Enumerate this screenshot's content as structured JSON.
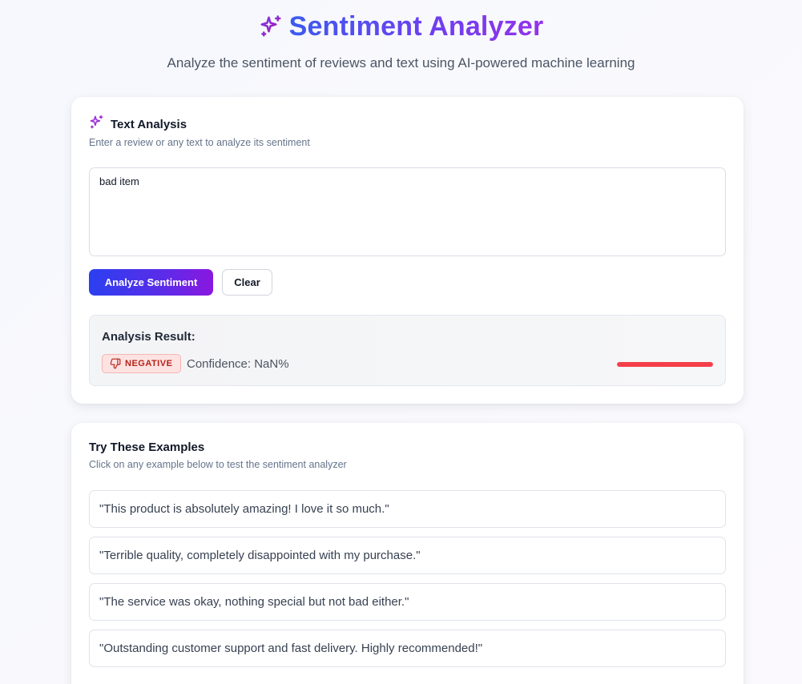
{
  "header": {
    "title": "Sentiment Analyzer",
    "subtitle": "Analyze the sentiment of reviews and text using AI-powered machine learning",
    "icon": "sparkles-icon"
  },
  "analysis": {
    "title": "Text Analysis",
    "description": "Enter a review or any text to analyze its sentiment",
    "input_value": "bad item",
    "analyze_label": "Analyze Sentiment",
    "clear_label": "Clear"
  },
  "result": {
    "heading": "Analysis Result:",
    "sentiment": "NEGATIVE",
    "sentiment_icon": "thumbs-down-icon",
    "confidence_text": "Confidence: NaN%",
    "bar_color": "#f43f4a"
  },
  "examples": {
    "title": "Try These Examples",
    "description": "Click on any example below to test the sentiment analyzer",
    "items": [
      "\"This product is absolutely amazing! I love it so much.\"",
      "\"Terrible quality, completely disappointed with my purchase.\"",
      "\"The service was okay, nothing special but not bad either.\"",
      "\"Outstanding customer support and fast delivery. Highly recommended!\""
    ]
  },
  "colors": {
    "brand_gradient_start": "#3b5bef",
    "brand_gradient_end": "#9333ea",
    "negative_badge_bg": "#fde2e2",
    "negative_text": "#b42318"
  }
}
